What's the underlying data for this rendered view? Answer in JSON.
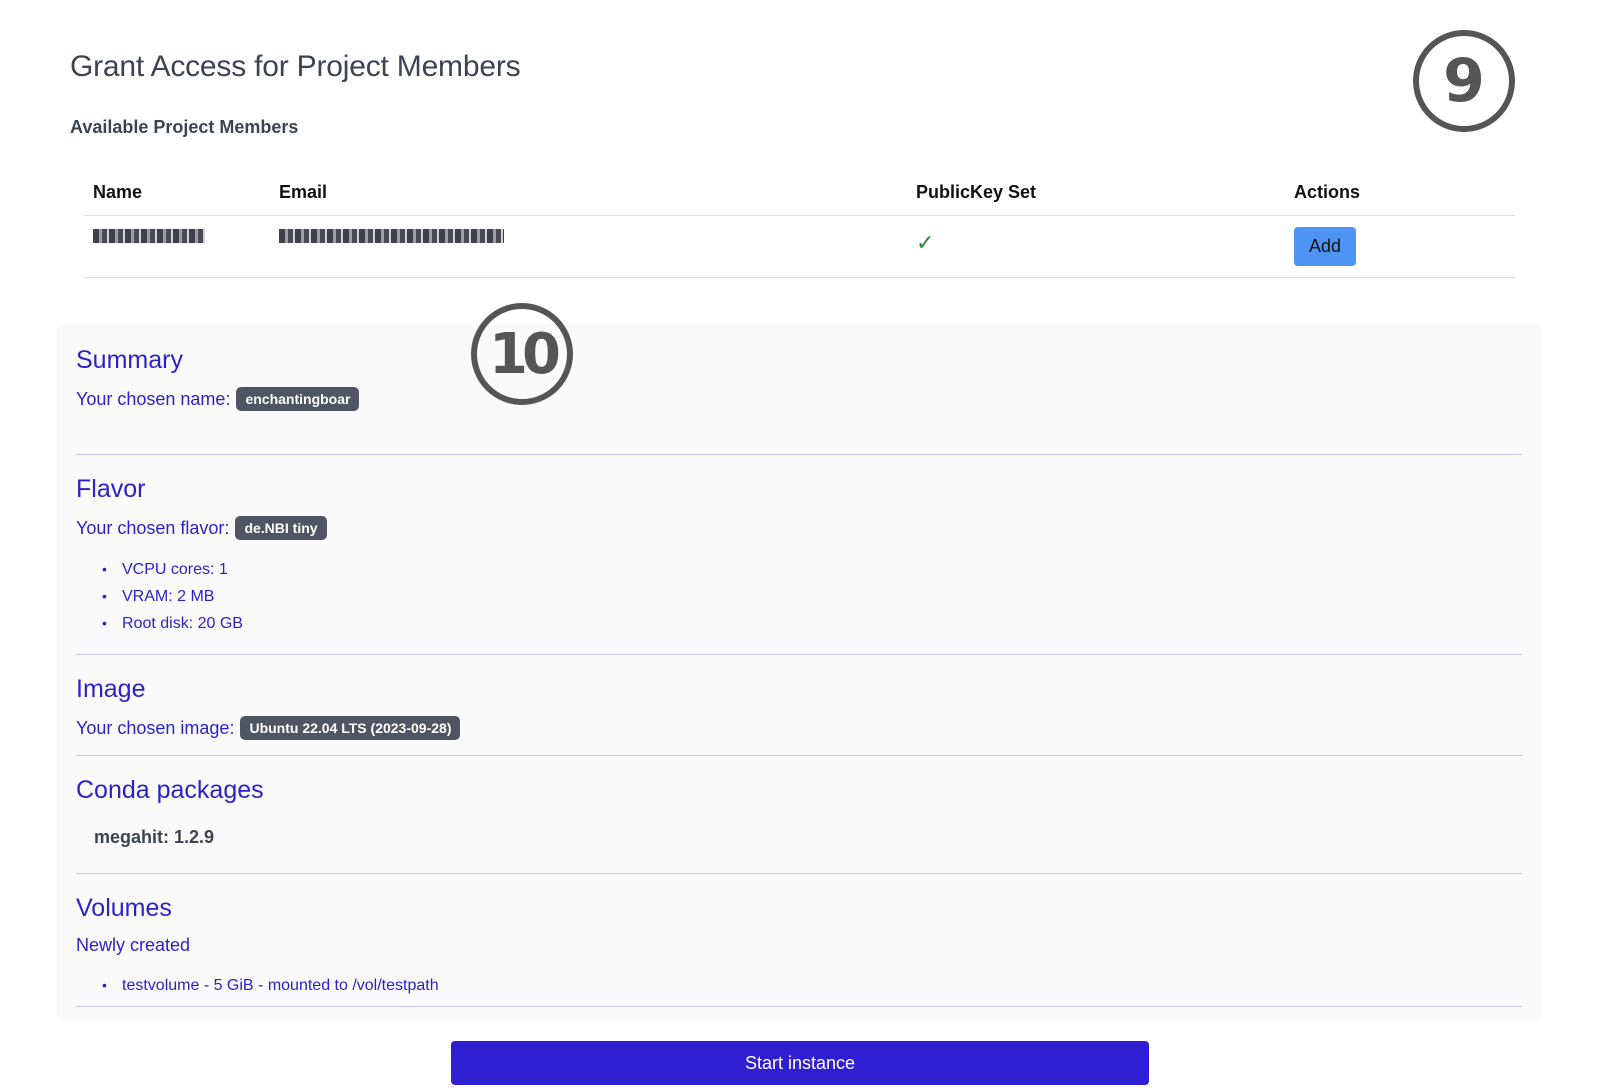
{
  "header": {
    "title": "Grant Access for Project Members",
    "subtitle": "Available Project Members"
  },
  "step_markers": {
    "first": "9",
    "second": "10"
  },
  "members_table": {
    "columns": [
      "Name",
      "Email",
      "PublicKey Set",
      "Actions"
    ],
    "rows": [
      {
        "name": "",
        "email": "",
        "public_key_set": "✓",
        "action_label": "Add"
      }
    ]
  },
  "summary": {
    "title": "Summary",
    "name_label": "Your chosen name:",
    "name_value": "enchantingboar"
  },
  "flavor": {
    "title": "Flavor",
    "label": "Your chosen flavor:",
    "value": "de.NBI tiny",
    "specs": [
      "VCPU cores: 1",
      "VRAM: 2 MB",
      "Root disk: 20 GB"
    ]
  },
  "image": {
    "title": "Image",
    "label": "Your chosen image:",
    "value": "Ubuntu 22.04 LTS (2023-09-28)"
  },
  "conda": {
    "title": "Conda packages",
    "packages": [
      "megahit: 1.2.9"
    ]
  },
  "volumes": {
    "title": "Volumes",
    "subheading": "Newly created",
    "items": [
      "testvolume - 5 GiB - mounted to /vol/testpath"
    ]
  },
  "actions": {
    "start_label": "Start instance"
  },
  "colors": {
    "accent": "#2b1fce",
    "primary_button": "#2f1fd3",
    "add_button": "#4d94f5",
    "badge": "#4f5563",
    "check": "#2e8b2e"
  }
}
